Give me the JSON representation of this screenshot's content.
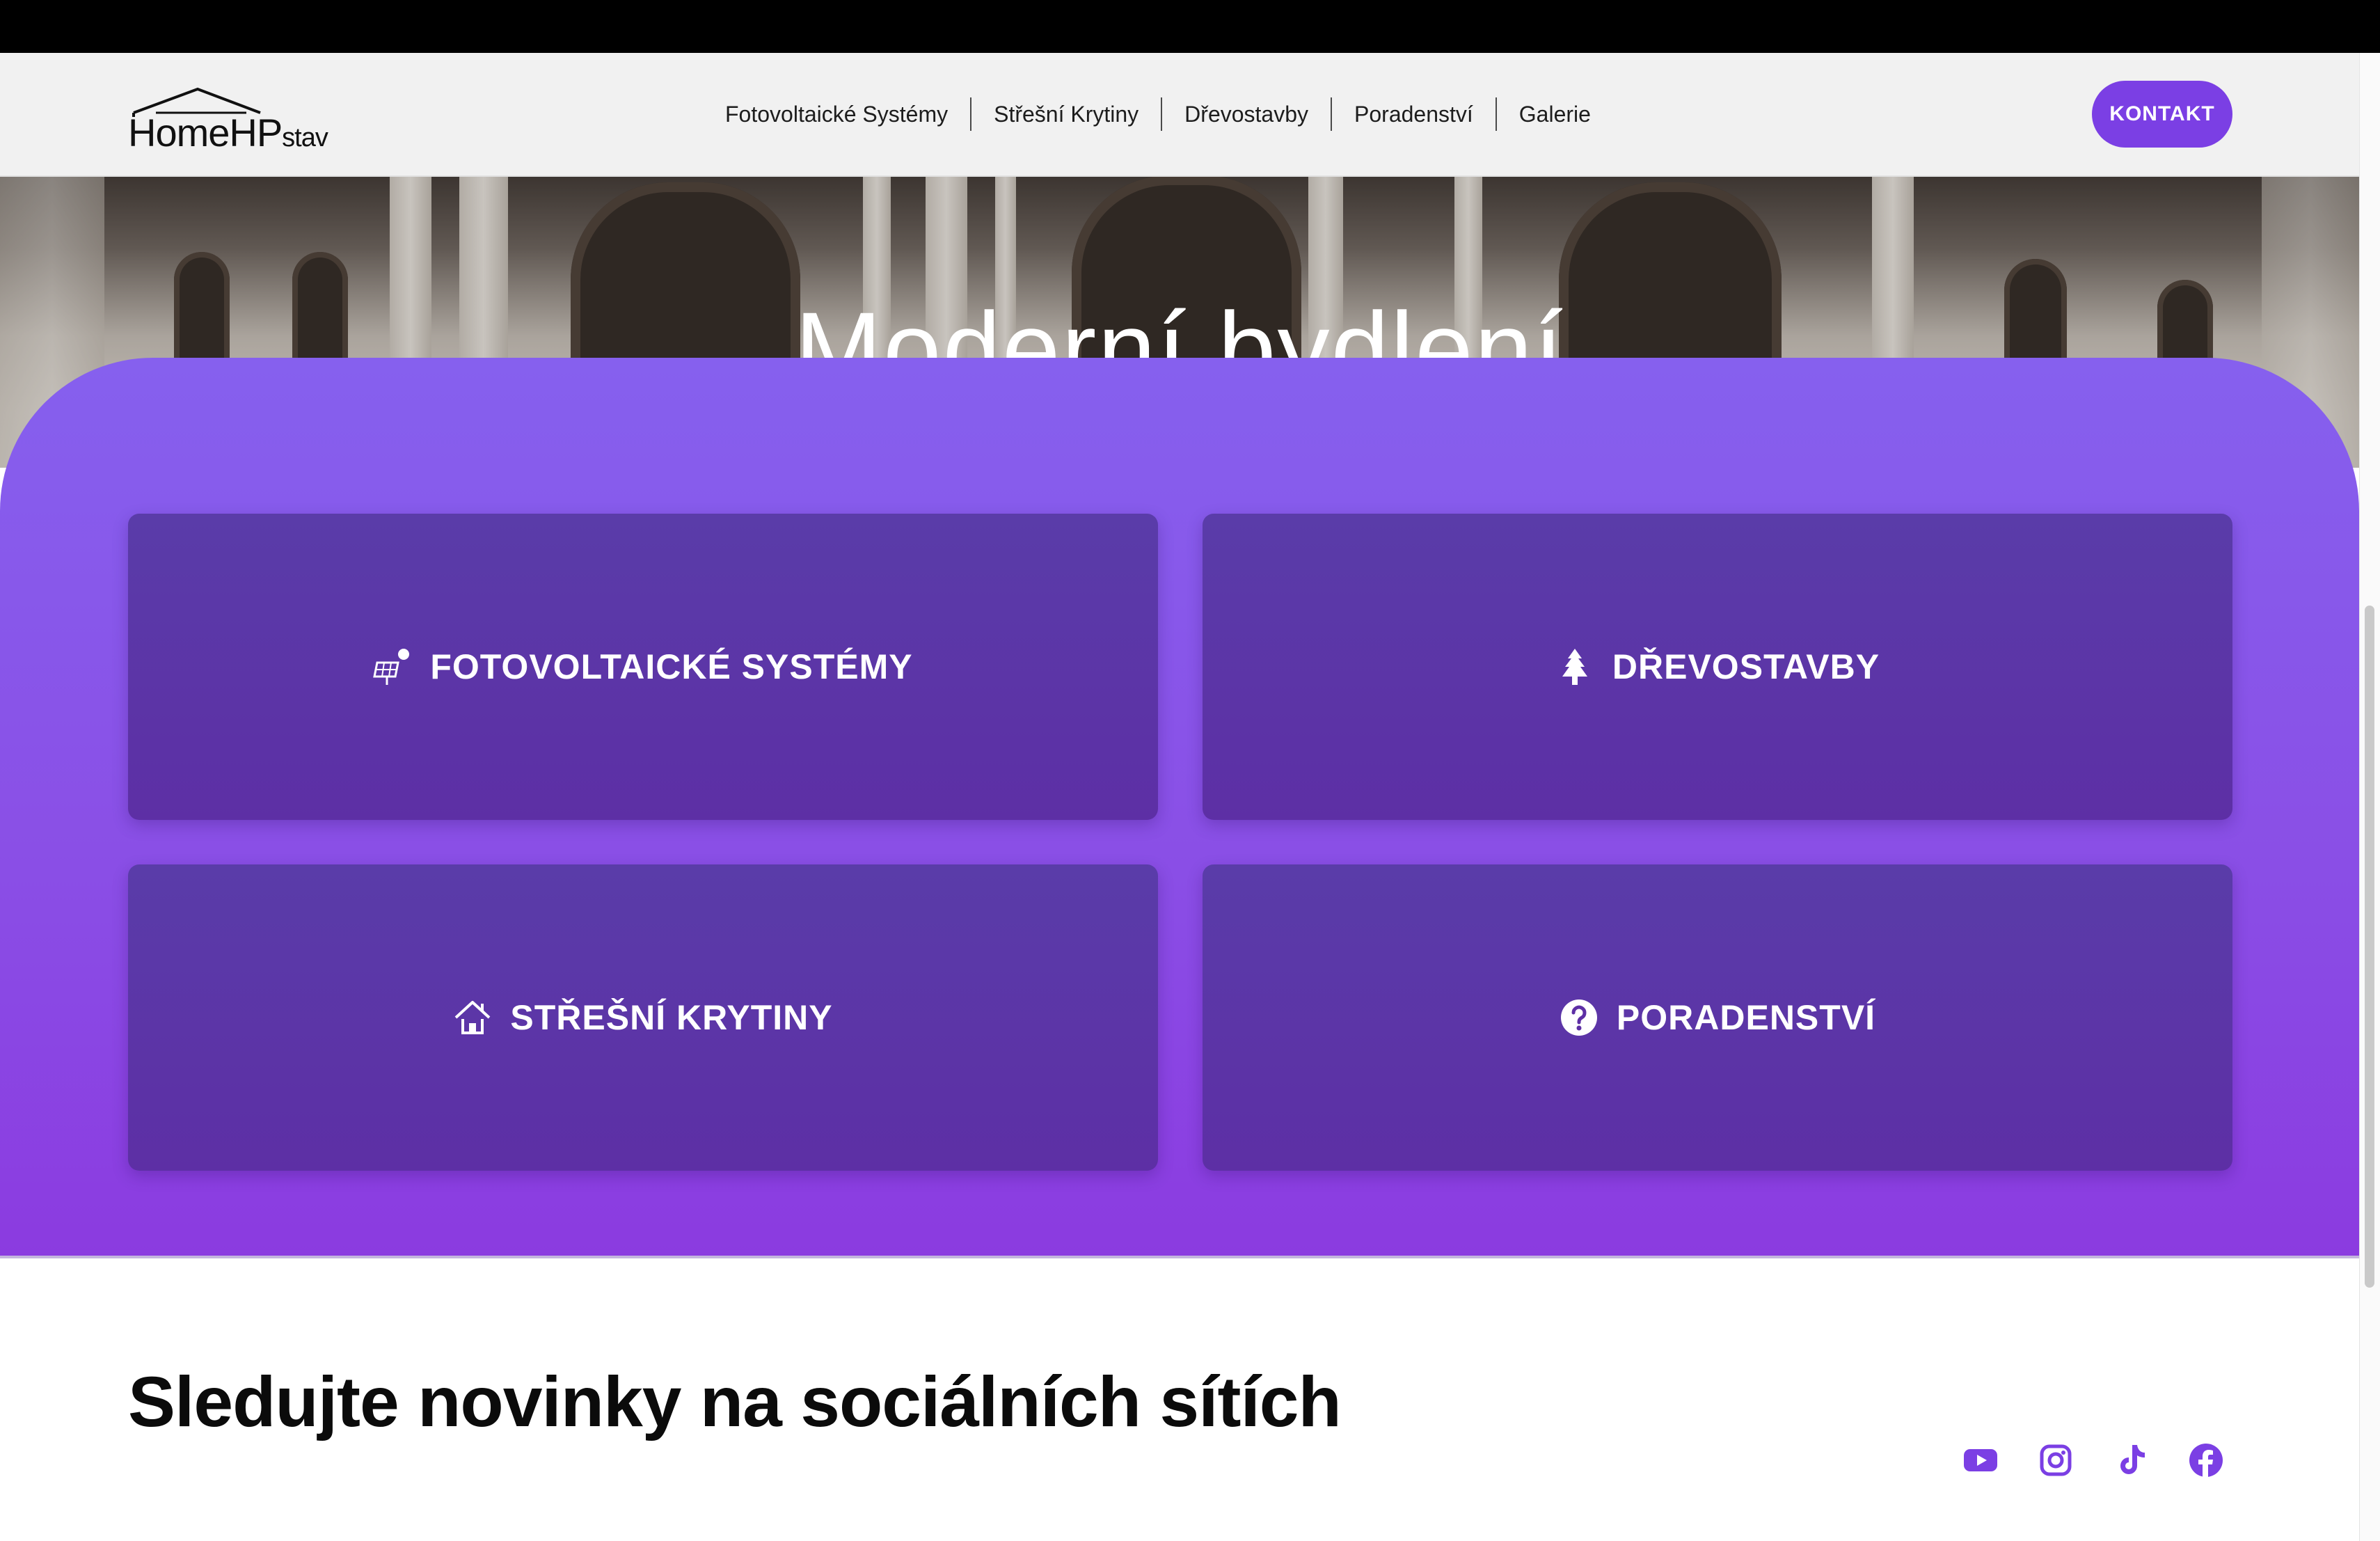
{
  "header": {
    "logo_main": "HomeHP",
    "logo_sub": "stav",
    "nav": [
      "Fotovoltaické Systémy",
      "Střešní Krytiny",
      "Dřevostavby",
      "Poradenství",
      "Galerie"
    ],
    "cta_label": "KONTAKT"
  },
  "hero": {
    "title": "Moderní bydlení"
  },
  "cards": [
    {
      "label": "FOTOVOLTAICKÉ SYSTÉMY",
      "icon": "solar-panel-icon"
    },
    {
      "label": "DŘEVOSTAVBY",
      "icon": "tree-icon"
    },
    {
      "label": "STŘEŠNÍ KRYTINY",
      "icon": "house-roof-icon"
    },
    {
      "label": "PORADENSTVÍ",
      "icon": "question-circle-icon"
    }
  ],
  "social": {
    "title": "Sledujte novinky na sociálních sítích",
    "icons": [
      "youtube-icon",
      "instagram-icon",
      "tiktok-icon",
      "facebook-icon"
    ]
  },
  "colors": {
    "accent": "#7b3fe4",
    "card": "#5d2fa5",
    "section_top": "#8660ee",
    "section_bottom": "#8b3be0"
  }
}
